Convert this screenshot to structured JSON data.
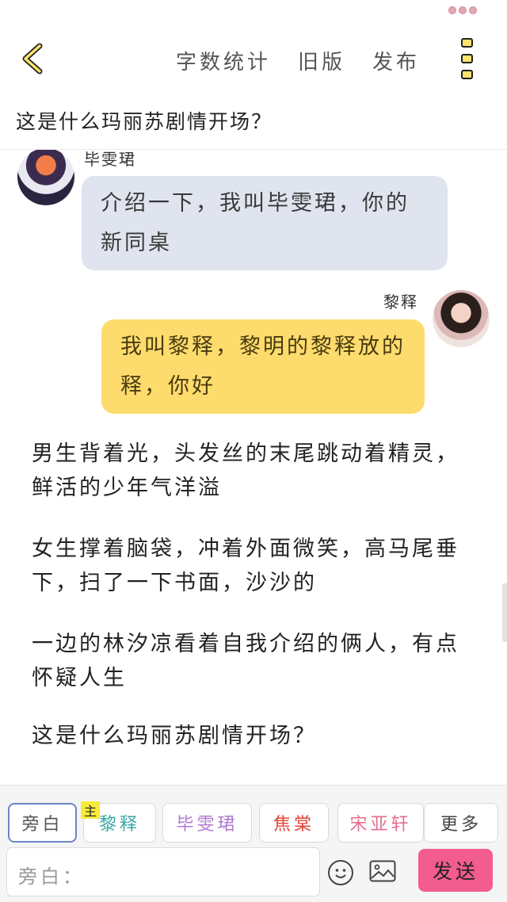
{
  "header": {
    "actions": [
      "字数统计",
      "旧版",
      "发布"
    ]
  },
  "chapter": {
    "title": "这是什么玛丽苏剧情开场？"
  },
  "messages": [
    {
      "speaker": "毕雯珺",
      "side": "left",
      "text": "介绍一下，我叫毕雯珺，你的新同桌"
    },
    {
      "speaker": "黎释",
      "side": "right",
      "text": "我叫黎释，黎明的黎释放的释，你好"
    }
  ],
  "narrations": [
    "男生背着光，头发丝的末尾跳动着精灵，鲜活的少年气洋溢",
    "女生撑着脑袋，冲着外面微笑，高马尾垂下，扫了一下书面，沙沙的",
    "一边的林汐凉看着自我介绍的俩人，有点怀疑人生",
    "这是什么玛丽苏剧情开场？"
  ],
  "roles": {
    "host_badge": "主",
    "tabs": [
      "旁白",
      "黎释",
      "毕雯珺",
      "焦棠",
      "宋亚轩",
      "更多"
    ],
    "active": "旁白",
    "colors": [
      "#555555",
      "#3aa7a5",
      "#b07ad0",
      "#e2453a",
      "#e26f8f",
      "#444444"
    ]
  },
  "composer": {
    "placeholder": "旁白：",
    "send_label": "发送"
  },
  "theme": {
    "accent_yellow": "#fddc6d",
    "bubble_gray": "#dfe4ee",
    "send_pink": "#f25c8f"
  }
}
